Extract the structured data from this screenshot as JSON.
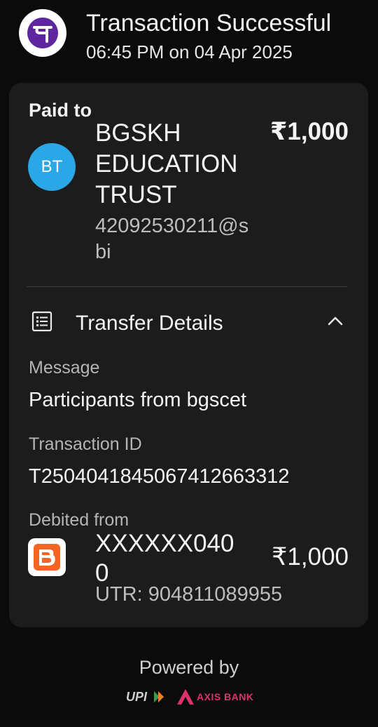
{
  "header": {
    "title": "Transaction Successful",
    "subtitle": "06:45 PM on 04 Apr 2025",
    "logo_icon": "phonepe-logo",
    "logo_glyph": "पे",
    "logo_color": "#5f259f"
  },
  "paid_to": {
    "label": "Paid to",
    "avatar_initials": "BT",
    "avatar_color": "#2aa7e6",
    "name": "BGSKH EDUCATION TRUST",
    "vpa": "42092530211@sbi",
    "amount": "₹1,000"
  },
  "transfer_details": {
    "label": "Transfer Details",
    "icon": "receipt-list-icon",
    "toggle_icon": "chevron-up-icon",
    "message_label": "Message",
    "message_value": "Participants from bgscet",
    "transaction_id_label": "Transaction ID",
    "transaction_id_value": "T2504041845067412663312",
    "debited_from_label": "Debited from",
    "bank_icon": "bank-of-baroda-logo",
    "account": "XXXXXX0400",
    "utr": "UTR: 904811089955",
    "amount": "₹1,000"
  },
  "footer": {
    "powered_by": "Powered by",
    "partner_logos": [
      "UPI",
      "AXIS BANK"
    ],
    "axis_label": "AXIS BANK",
    "axis_color": "#e0306a"
  }
}
